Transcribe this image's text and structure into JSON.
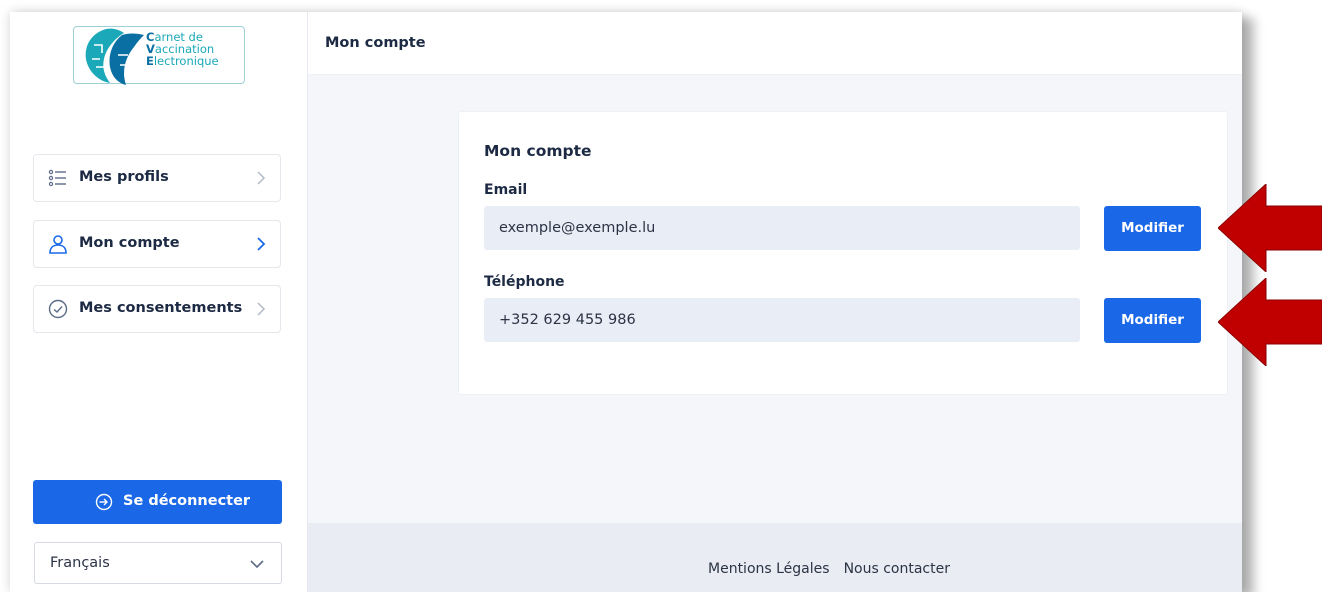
{
  "logo": {
    "line1_initial": "C",
    "line1_rest": "arnet de",
    "line2_initial": "V",
    "line2_rest": "accination",
    "line3_initial": "E",
    "line3_rest": "lectronique"
  },
  "sidebar": {
    "items": [
      {
        "label": "Mes profils",
        "icon": "list-icon",
        "active": false
      },
      {
        "label": "Mon compte",
        "icon": "user-icon",
        "active": true
      },
      {
        "label": "Mes consentements",
        "icon": "check-circle-icon",
        "active": false
      }
    ],
    "logout_label": "Se déconnecter",
    "language": {
      "selected": "Français"
    }
  },
  "header": {
    "title": "Mon compte"
  },
  "account": {
    "title": "Mon compte",
    "email": {
      "label": "Email",
      "value": "exemple@exemple.lu",
      "button": "Modifier"
    },
    "phone": {
      "label": "Téléphone",
      "value": "+352 629 455 986",
      "button": "Modifier"
    }
  },
  "footer": {
    "legal": "Mentions Légales",
    "contact": "Nous contacter"
  },
  "colors": {
    "primary": "#1a68e8",
    "sidebar_text": "#1d2a44",
    "input_bg": "#e9eef6",
    "content_bg": "#f4f6fa",
    "annotation_arrow": "#c00000"
  }
}
